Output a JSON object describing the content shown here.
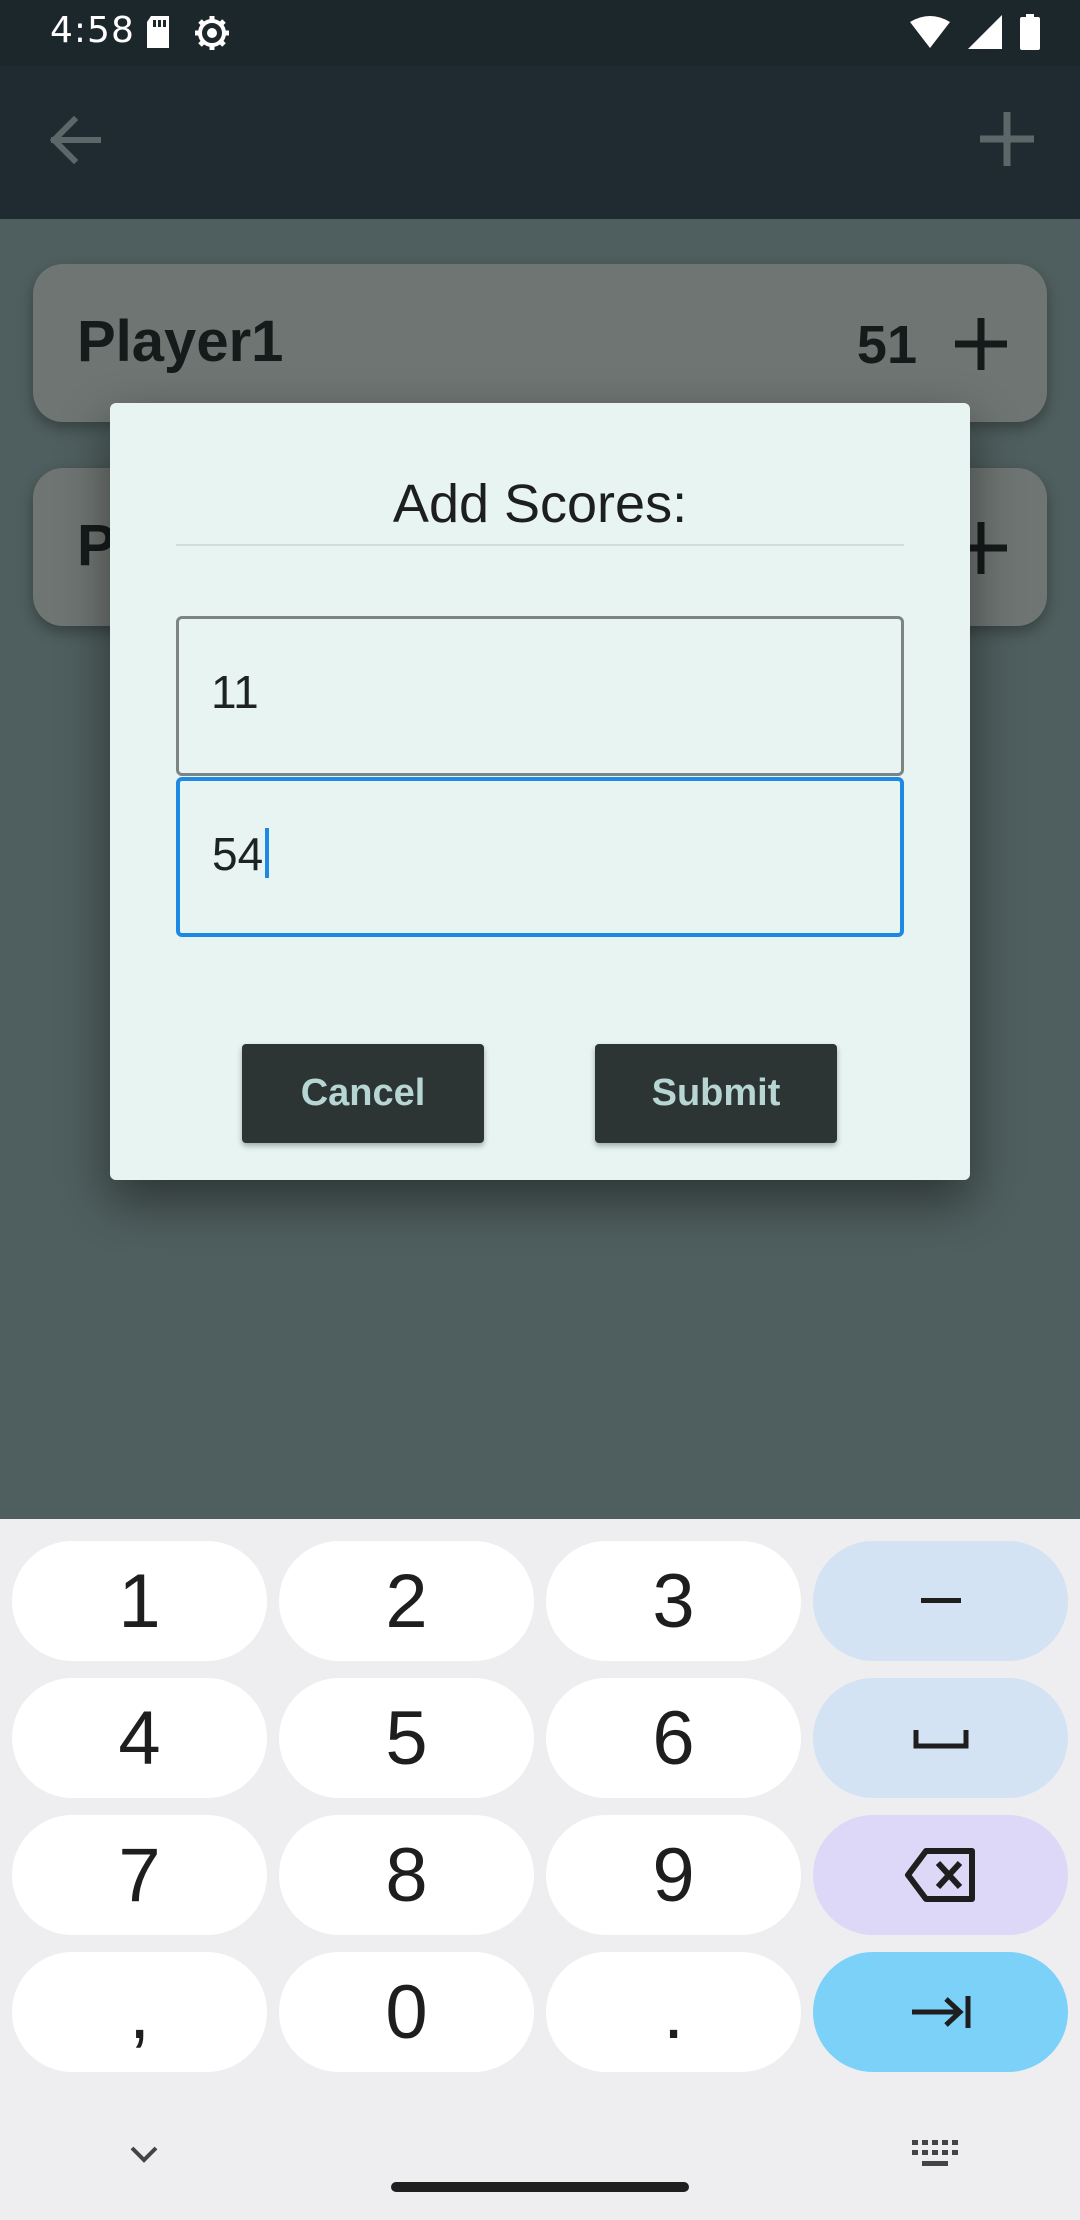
{
  "status_bar": {
    "time": "4:58",
    "icons_left": [
      "sd-card-icon",
      "settings-gear-icon"
    ],
    "icons_right": [
      "wifi-icon",
      "cell-signal-icon",
      "battery-icon"
    ]
  },
  "app_bar": {
    "back_icon": "arrow-back-icon",
    "add_icon": "plus-icon"
  },
  "players": [
    {
      "name": "Player1",
      "score": "51"
    },
    {
      "name": "P",
      "score": ""
    }
  ],
  "dialog": {
    "title": "Add Scores:",
    "inputs": [
      {
        "value": "11",
        "focused": false
      },
      {
        "value": "54",
        "focused": true
      }
    ],
    "cancel_label": "Cancel",
    "submit_label": "Submit"
  },
  "keyboard": {
    "keys": [
      [
        "1",
        "2",
        "3",
        "–"
      ],
      [
        "4",
        "5",
        "6",
        "␣"
      ],
      [
        "7",
        "8",
        "9",
        "⌫"
      ],
      [
        ",",
        "0",
        ".",
        "⇥"
      ]
    ]
  },
  "colors": {
    "status_bar": "#1c272c",
    "app_bar": "#1f2b30",
    "scrim": "#4f5e5e",
    "dialog_bg": "#e7f4f1",
    "focus_blue": "#1e88e5",
    "button_bg": "#2c3434",
    "button_text": "#b6d5d3"
  }
}
